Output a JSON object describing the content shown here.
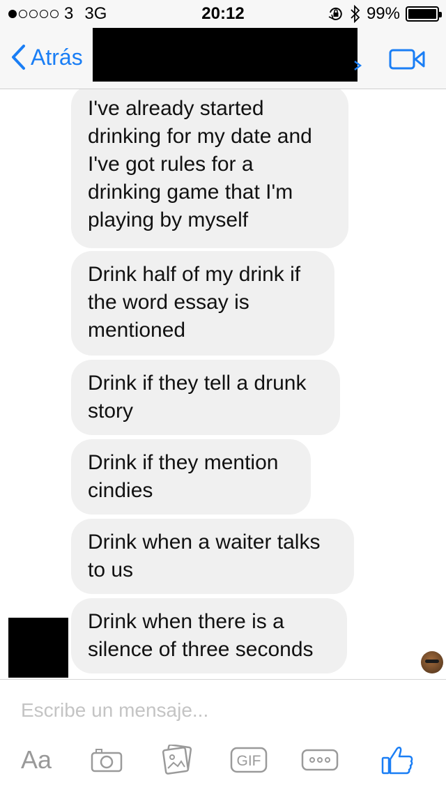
{
  "status_bar": {
    "carrier": "3",
    "network": "3G",
    "time": "20:12",
    "battery_text": "99%",
    "battery_level": 0.99,
    "signal_filled": 1,
    "signal_total": 5,
    "icons": [
      "orientation-lock-icon",
      "bluetooth-icon",
      "battery-icon"
    ]
  },
  "nav": {
    "back_label": "Atrás",
    "accent_color": "#1a7ef5",
    "icons": [
      "back-chevron-icon",
      "video-call-icon"
    ]
  },
  "messages": [
    {
      "text": "I've already started drinking for my date and I've got rules for a drinking game that I'm playing by myself"
    },
    {
      "text": "Drink half of my drink if the word essay is mentioned"
    },
    {
      "text": "Drink if they tell a drunk story"
    },
    {
      "text": "Drink if they mention cindies"
    },
    {
      "text": "Drink when a waiter talks to us"
    },
    {
      "text": "Drink when there is a silence of three seconds"
    }
  ],
  "composer": {
    "placeholder": "Escribe un mensaje...",
    "aa_label": "Aa",
    "gif_label": "GIF",
    "icons": [
      "camera-icon",
      "gallery-icon",
      "gif-icon",
      "more-icon",
      "like-icon"
    ]
  }
}
